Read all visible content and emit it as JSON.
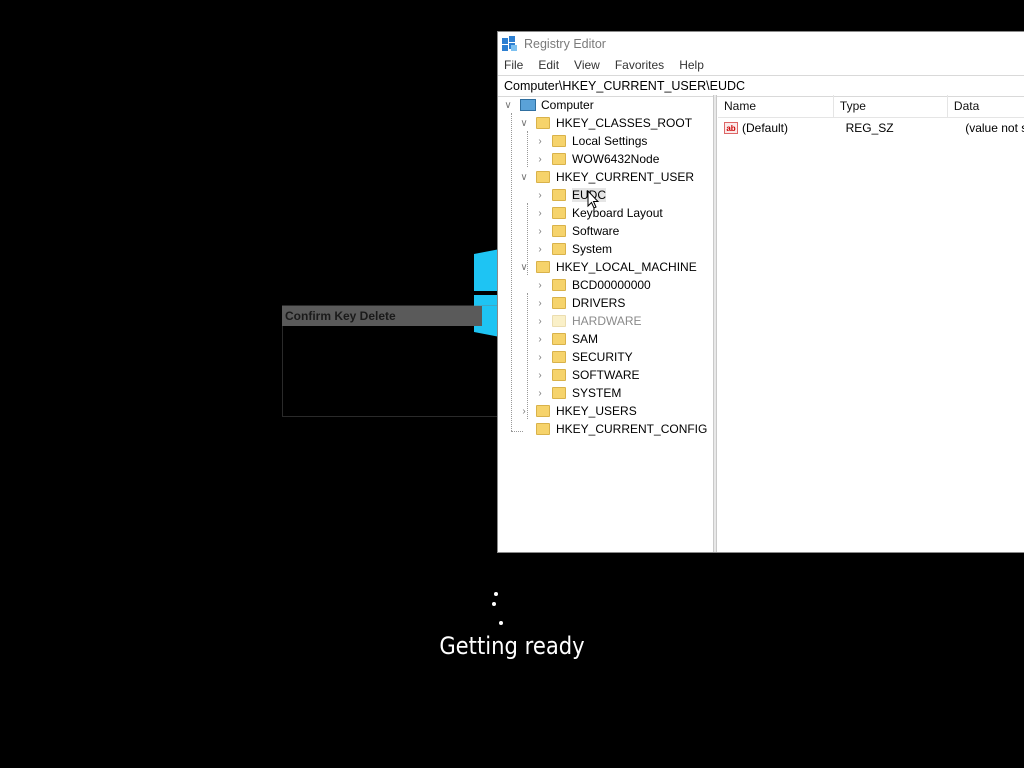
{
  "window": {
    "title": "Registry Editor",
    "menu": [
      "File",
      "Edit",
      "View",
      "Favorites",
      "Help"
    ],
    "address": "Computer\\HKEY_CURRENT_USER\\EUDC"
  },
  "tree": {
    "root": "Computer",
    "hkcr": "HKEY_CLASSES_ROOT",
    "hkcr_children": [
      "Local Settings",
      "WOW6432Node"
    ],
    "hkcu": "HKEY_CURRENT_USER",
    "hkcu_children": [
      "EUDC",
      "Keyboard Layout",
      "Software",
      "System"
    ],
    "hklm": "HKEY_LOCAL_MACHINE",
    "hklm_children": [
      "BCD00000000",
      "DRIVERS",
      "HARDWARE",
      "SAM",
      "SECURITY",
      "SOFTWARE",
      "SYSTEM"
    ],
    "hku": "HKEY_USERS",
    "hkcc": "HKEY_CURRENT_CONFIG",
    "selected": "EUDC"
  },
  "list": {
    "columns": [
      "Name",
      "Type",
      "Data"
    ],
    "rows": [
      {
        "name": "(Default)",
        "type": "REG_SZ",
        "data": "(value not s"
      }
    ]
  },
  "dialog": {
    "title": "Confirm Key Delete"
  },
  "status": {
    "message": "Getting ready"
  },
  "icons": {
    "ab": "ab"
  },
  "colors": {
    "accent": "#1ec4f3",
    "folder": "#f6d36b"
  }
}
